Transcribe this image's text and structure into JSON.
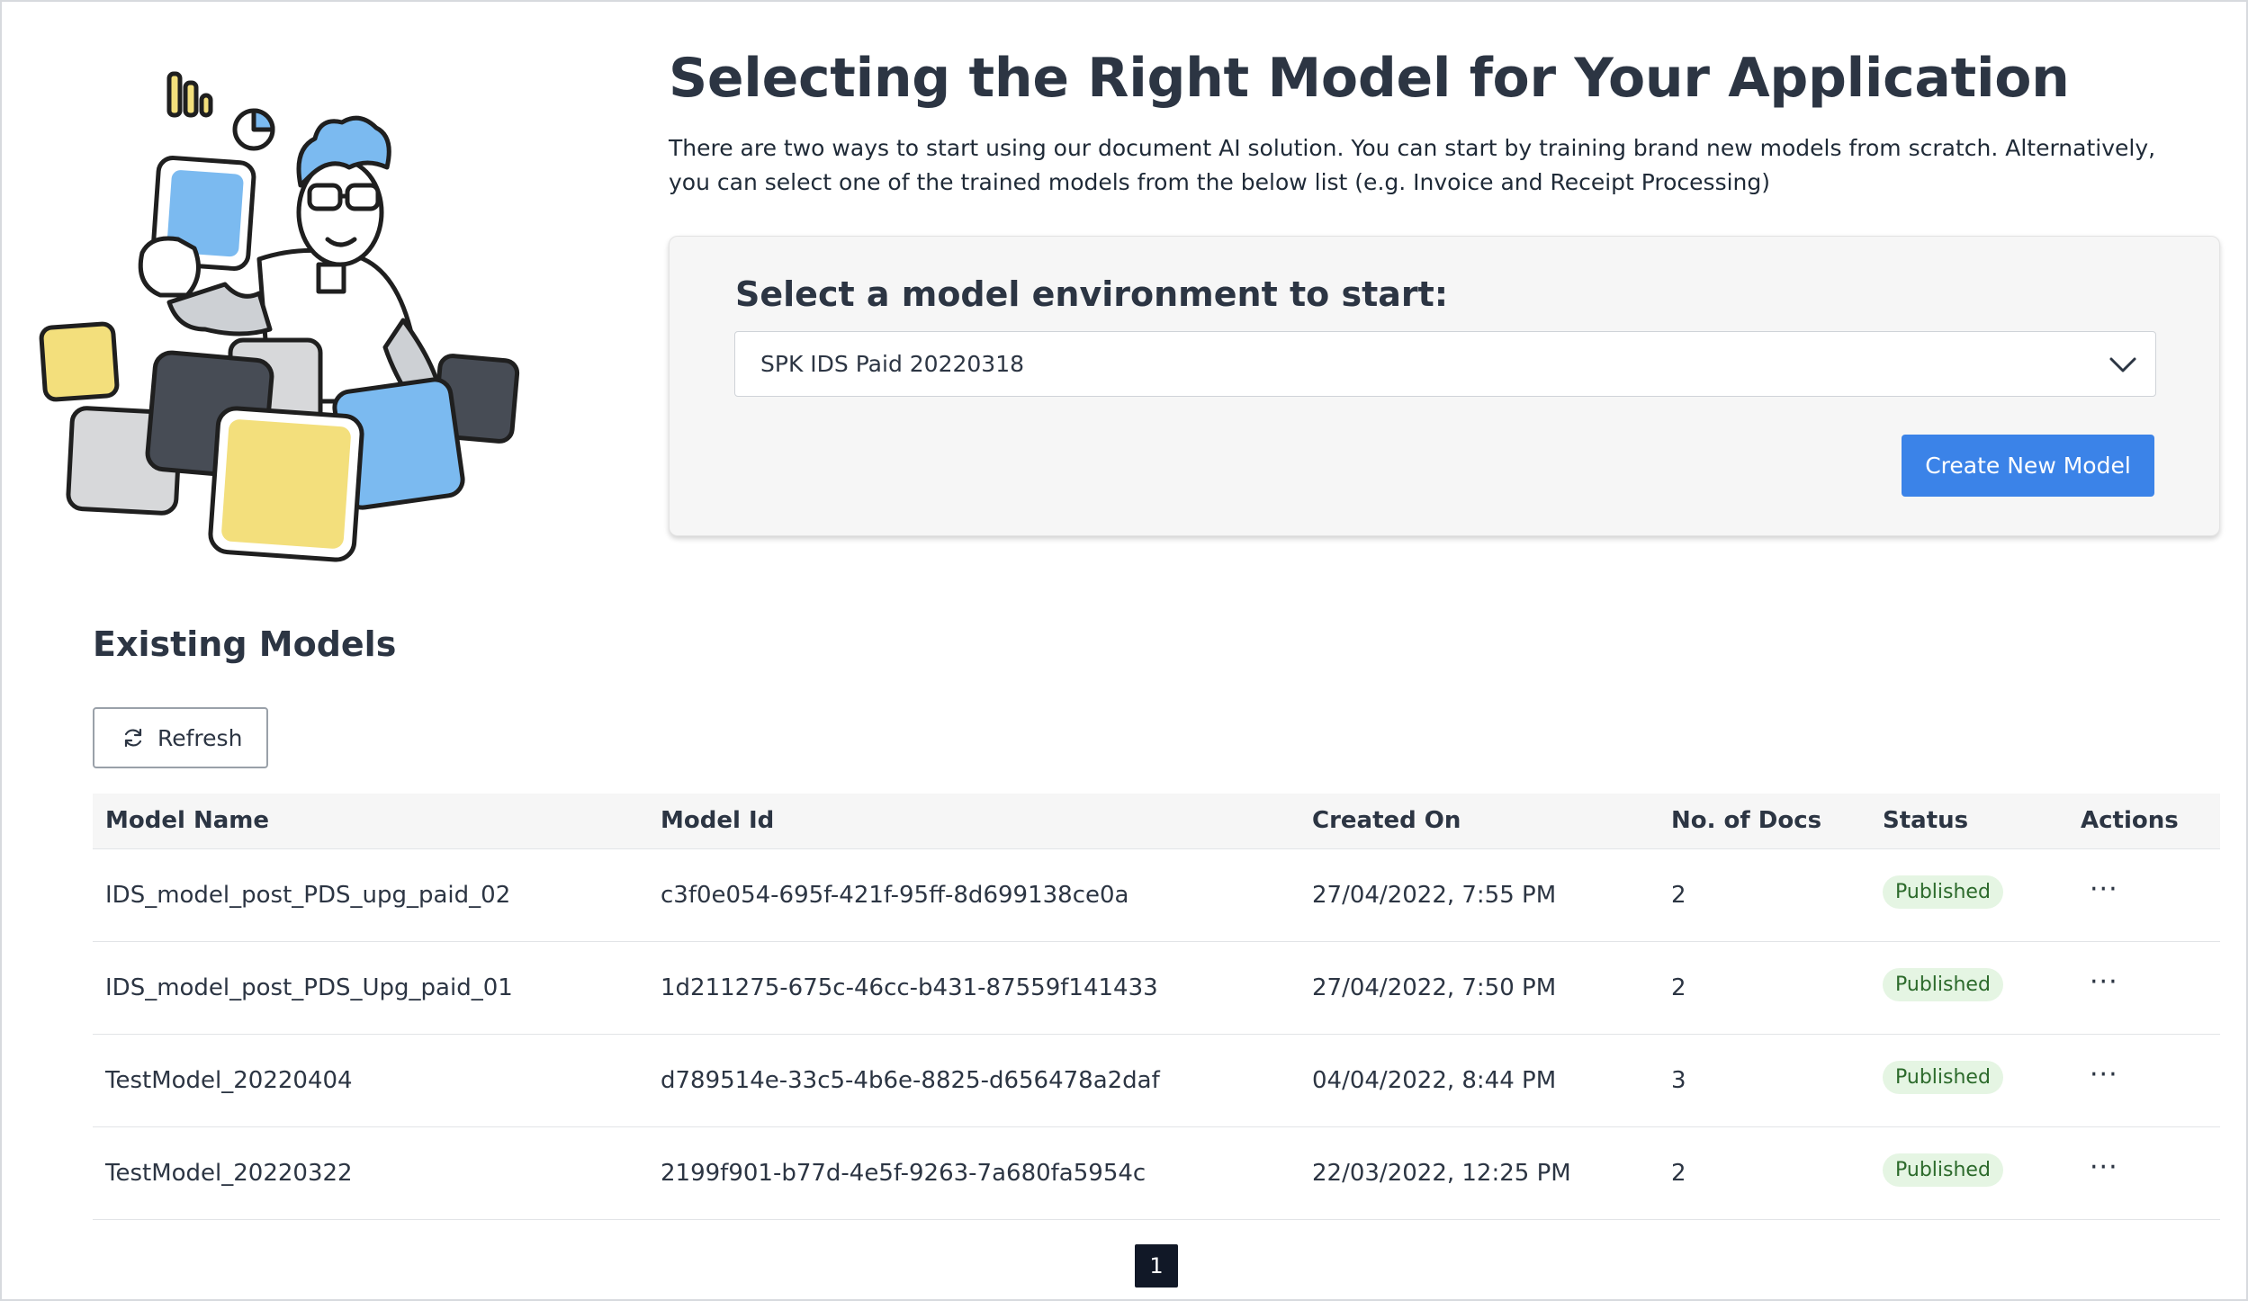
{
  "header": {
    "title": "Selecting the Right Model for Your Application",
    "description": "There are two ways to start using our document AI solution. You can start by training brand new models from scratch. Alternatively, you can select one of the trained models from the below list (e.g. Invoice and Receipt Processing)"
  },
  "illustration": {
    "icon": "person-holding-cards-illustration"
  },
  "environment": {
    "heading": "Select a model environment to start:",
    "selected_value": "SPK IDS Paid 20220318",
    "chevron_icon": "chevron-down-icon",
    "create_button_label": "Create New Model",
    "accent_color": "#3b83e8"
  },
  "models": {
    "section_title": "Existing Models",
    "refresh_label": "Refresh",
    "refresh_icon": "refresh-icon",
    "columns": [
      "Model Name",
      "Model Id",
      "Created On",
      "No. of Docs",
      "Status",
      "Actions"
    ],
    "rows": [
      {
        "name": "IDS_model_post_PDS_upg_paid_02",
        "id": "c3f0e054-695f-421f-95ff-8d699138ce0a",
        "created": "27/04/2022, 7:55 PM",
        "docs": "2",
        "status": "Published",
        "actions": "···"
      },
      {
        "name": "IDS_model_post_PDS_Upg_paid_01",
        "id": "1d211275-675c-46cc-b431-87559f141433",
        "created": "27/04/2022, 7:50 PM",
        "docs": "2",
        "status": "Published",
        "actions": "···"
      },
      {
        "name": "TestModel_20220404",
        "id": "d789514e-33c5-4b6e-8825-d656478a2daf",
        "created": "04/04/2022, 8:44 PM",
        "docs": "3",
        "status": "Published",
        "actions": "···"
      },
      {
        "name": "TestModel_20220322",
        "id": "2199f901-b77d-4e5f-9263-7a680fa5954c",
        "created": "22/03/2022, 12:25 PM",
        "docs": "2",
        "status": "Published",
        "actions": "···"
      }
    ],
    "status_color": "#e5f5e3"
  },
  "pagination": {
    "current_page": "1"
  }
}
